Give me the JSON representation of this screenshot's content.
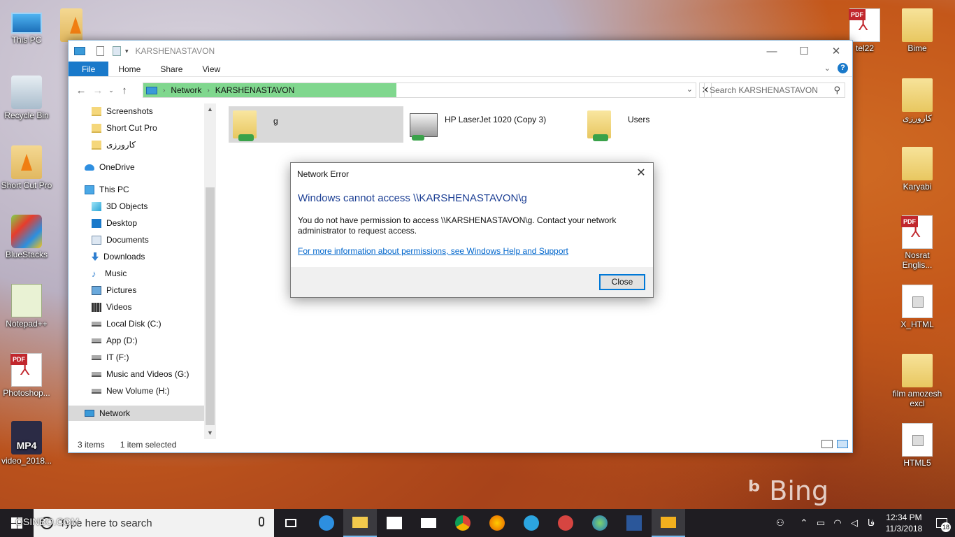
{
  "desktop": {
    "left_icons": [
      {
        "label": "This PC",
        "icon": "this-pc-icon"
      },
      {
        "label": "Recycle Bin",
        "icon": "recycle-bin-icon"
      },
      {
        "label": "Short Cut Pro",
        "icon": "vlc-shortcut-icon"
      },
      {
        "label": "BlueStacks",
        "icon": "bluestacks-icon"
      },
      {
        "label": "Notepad++",
        "icon": "notepad-plus-plus-icon"
      },
      {
        "label": "Photoshop...",
        "icon": "pdf-file-icon"
      },
      {
        "label": "video_2018...",
        "icon": "mp4-file-icon"
      }
    ],
    "right_icons": [
      {
        "label": "tel22",
        "icon": "pdf-file-icon"
      },
      {
        "label": "Bime",
        "icon": "folder-icon"
      },
      {
        "label": "کارورزی",
        "icon": "folder-icon"
      },
      {
        "label": "Karyabi",
        "icon": "folder-icon"
      },
      {
        "label": "Nosrat Englis...",
        "icon": "pdf-file-icon"
      },
      {
        "label": "X_HTML",
        "icon": "file-icon"
      },
      {
        "label": "film amozesh excl",
        "icon": "folder-icon"
      },
      {
        "label": "HTML5",
        "icon": "file-icon"
      }
    ],
    "mp4_text": "MP4",
    "watermark": "Bing"
  },
  "explorer": {
    "title": "KARSHENASTAVON",
    "ribbon_tabs": [
      "File",
      "Home",
      "Share",
      "View"
    ],
    "address": {
      "root": "Network",
      "current": "KARSHENASTAVON"
    },
    "search_placeholder": "Search KARSHENASTAVON",
    "nav_items": [
      {
        "label": "Screenshots",
        "icon": "folder-icon"
      },
      {
        "label": "Short Cut Pro",
        "icon": "folder-icon"
      },
      {
        "label": "کارورزی",
        "icon": "folder-icon"
      },
      {
        "label": "OneDrive",
        "icon": "onedrive-icon"
      },
      {
        "label": "This PC",
        "icon": "this-pc-icon"
      },
      {
        "label": "3D Objects",
        "icon": "3d-objects-icon"
      },
      {
        "label": "Desktop",
        "icon": "desktop-icon"
      },
      {
        "label": "Documents",
        "icon": "documents-icon"
      },
      {
        "label": "Downloads",
        "icon": "downloads-icon"
      },
      {
        "label": "Music",
        "icon": "music-icon"
      },
      {
        "label": "Pictures",
        "icon": "pictures-icon"
      },
      {
        "label": "Videos",
        "icon": "videos-icon"
      },
      {
        "label": "Local Disk (C:)",
        "icon": "disk-icon"
      },
      {
        "label": "App (D:)",
        "icon": "disk-icon"
      },
      {
        "label": "IT (F:)",
        "icon": "disk-icon"
      },
      {
        "label": "Music and Videos (G:)",
        "icon": "disk-icon"
      },
      {
        "label": "New Volume (H:)",
        "icon": "disk-icon"
      },
      {
        "label": "Network",
        "icon": "network-icon",
        "selected": true
      }
    ],
    "items": [
      {
        "label": "g",
        "icon": "shared-folder-icon",
        "selected": true
      },
      {
        "label": "HP LaserJet 1020 (Copy 3)",
        "icon": "printer-icon"
      },
      {
        "label": "Users",
        "icon": "shared-folder-icon"
      }
    ],
    "status": {
      "count": "3 items",
      "selection": "1 item selected"
    }
  },
  "dialog": {
    "title": "Network Error",
    "heading": "Windows cannot access \\\\KARSHENASTAVON\\g",
    "body": "You do not have permission to access \\\\KARSHENASTAVON\\g. Contact your network administrator to request access.",
    "link": "For more information about permissions, see Windows Help and Support",
    "button": "Close"
  },
  "taskbar": {
    "search_placeholder": "Type here to search",
    "watermark": "OSINBO.COM",
    "apps": [
      "task-view-icon",
      "edge-icon",
      "file-explorer-icon",
      "store-icon",
      "mail-icon",
      "chrome-icon",
      "firefox-icon",
      "telegram-icon",
      "pushbullet-icon",
      "network-app-icon",
      "word-icon",
      "media-player-icon"
    ],
    "lang": "فا",
    "time": "12:34 PM",
    "date": "11/3/2018",
    "notifications": "18"
  }
}
